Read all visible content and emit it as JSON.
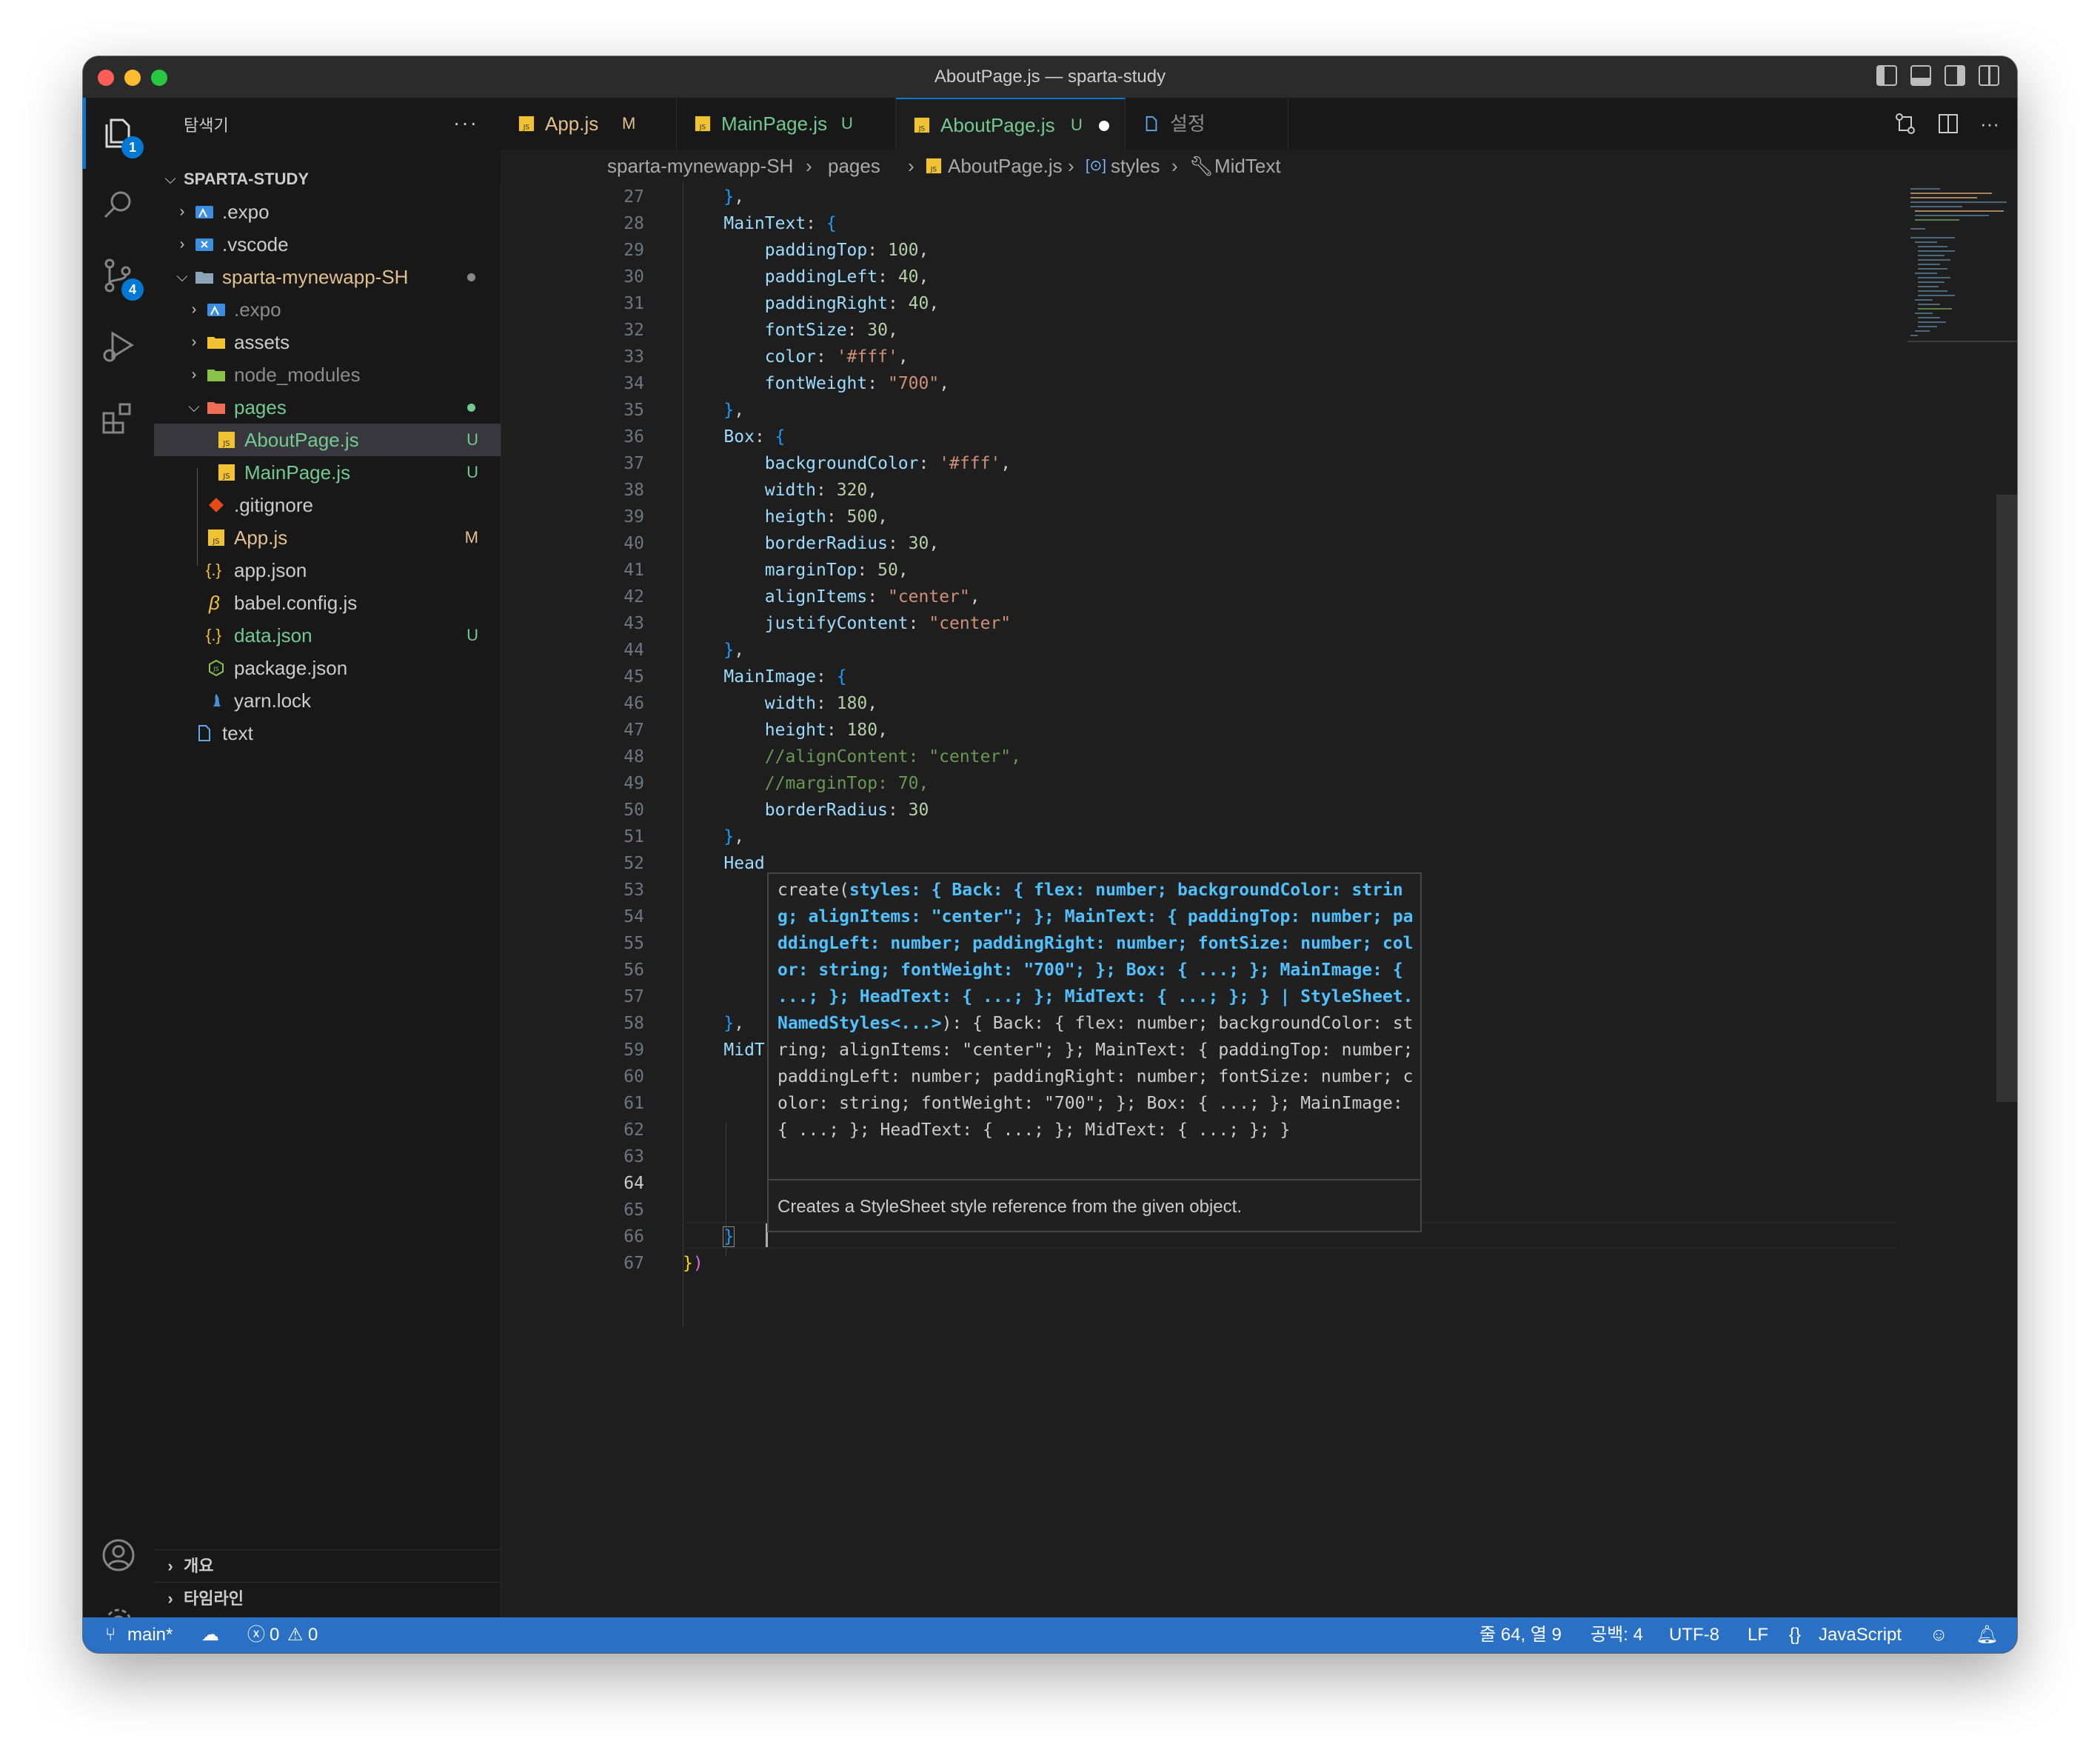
{
  "window": {
    "title": "AboutPage.js — sparta-study"
  },
  "activity": {
    "explorer_badge": "1",
    "scm_badge": "4"
  },
  "sidebar": {
    "header": "탐색기",
    "more": "···",
    "root": "SPARTA-STUDY",
    "items": [
      {
        "name": ".expo",
        "status": ""
      },
      {
        "name": ".vscode",
        "status": ""
      },
      {
        "name": "sparta-mynewapp-SH",
        "status": ""
      },
      {
        "name": ".expo",
        "status": ""
      },
      {
        "name": "assets",
        "status": ""
      },
      {
        "name": "node_modules",
        "status": ""
      },
      {
        "name": "pages",
        "status": ""
      },
      {
        "name": "AboutPage.js",
        "status": "U"
      },
      {
        "name": "MainPage.js",
        "status": "U"
      },
      {
        "name": ".gitignore",
        "status": ""
      },
      {
        "name": "App.js",
        "status": "M"
      },
      {
        "name": "app.json",
        "status": ""
      },
      {
        "name": "babel.config.js",
        "status": ""
      },
      {
        "name": "data.json",
        "status": "U"
      },
      {
        "name": "package.json",
        "status": ""
      },
      {
        "name": "yarn.lock",
        "status": ""
      },
      {
        "name": "text",
        "status": ""
      }
    ],
    "outline": "개요",
    "timeline": "타임라인"
  },
  "tabs": [
    {
      "label": "App.js",
      "status": "M"
    },
    {
      "label": "MainPage.js",
      "status": "U"
    },
    {
      "label": "AboutPage.js",
      "status": "U"
    },
    {
      "label": "설정",
      "status": ""
    }
  ],
  "breadcrumb": [
    "sparta-mynewapp-SH",
    "pages",
    "AboutPage.js",
    "styles",
    "MidText"
  ],
  "hover": {
    "sig_prefix": "create(",
    "sig_highlight": "styles: { Back: { flex: number; backgroundColor: string; alignItems: \"center\"; }; MainText: { paddingTop: number; paddingLeft: number; paddingRight: number; fontSize: number; color: string; fontWeight: \"700\"; }; Box: { ...; }; MainImage: { ...; }; HeadText: { ...; }; MidText: { ...; }; } | StyleSheet.NamedStyles<...>",
    "sig_suffix": "): { Back: { flex: number; backgroundColor: string; alignItems: \"center\"; }; MainText: { paddingTop: number; paddingLeft: number; paddingRight: number; fontSize: number; color: string; fontWeight: \"700\"; }; Box: { ...; }; MainImage: { ...; }; HeadText: { ...; }; MidText: { ...; }; }",
    "doc": "Creates a StyleSheet style reference from the given object."
  },
  "status": {
    "branch": "main*",
    "errors": "0",
    "warnings": "0",
    "position": "줄 64, 열 9",
    "spaces": "공백: 4",
    "encoding": "UTF-8",
    "eol": "LF",
    "language": "JavaScript"
  },
  "colors": {
    "accent": "#0078d4",
    "statusbar": "#2a71c6",
    "untracked": "#73c991",
    "modified": "#e2c08d"
  }
}
